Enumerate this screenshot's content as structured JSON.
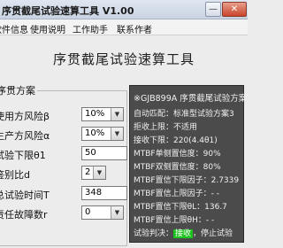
{
  "window": {
    "title": "序贯截尾试验速算工具 V1.00",
    "minimize_glyph": "—",
    "close_glyph": "✕"
  },
  "menu": [
    "软件信息",
    "使用说明",
    "工作助手",
    "联系作者"
  ],
  "heading": "序贯截尾试验速算工具",
  "scheme_group": {
    "title": "序贯方案",
    "fields": [
      {
        "label": "使用方风险β",
        "value": "10%",
        "type": "combo"
      },
      {
        "label": "生产方风险α",
        "value": "10%",
        "type": "combo"
      },
      {
        "label": "试验下限θ1",
        "value": "50",
        "type": "text"
      },
      {
        "label": "鉴别比d",
        "value": "2",
        "type": "combo"
      },
      {
        "label": "总试验时间T",
        "value": "348",
        "type": "text"
      },
      {
        "label": "责任故障数r",
        "value": "0",
        "type": "combo"
      }
    ]
  },
  "results": {
    "header": "※GJB899A 序贯截尾试验方案",
    "lines": [
      "自动匹配：标准型试验方案3",
      "拒收上限：不适用",
      "接收下限：220(4.4θ1)",
      "MTBF单侧置信度：90%",
      "MTBF双侧置信度：80%",
      "MTBF置信下限因子：2.7339",
      "MTBF置信上限因子：- -",
      "MTBF置信下限θL：136.7",
      "MTBF置信上限θH：- -"
    ],
    "verdict_prefix": "试验判决：",
    "verdict_status": "接收",
    "verdict_suffix": "，停止试验"
  }
}
